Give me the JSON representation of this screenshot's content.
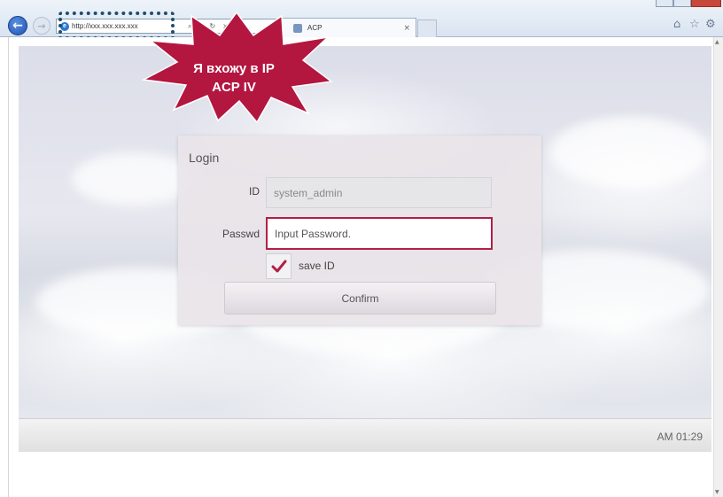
{
  "browser": {
    "address_url": "http://xxx.xxx.xxx.xxx",
    "search_icon": "search-icon",
    "address_separator": "▾",
    "refresh_icon": "↻",
    "stop_icon": "×",
    "tab_title": "ACP",
    "tab_close": "×",
    "toolbar_icons": [
      "home-icon",
      "star-icon",
      "gear-icon"
    ]
  },
  "callout": {
    "text_line1": "Я вхожу в IP",
    "text_line2": "ACP IV",
    "color": "#b3163f"
  },
  "login": {
    "title": "Login",
    "id_label": "ID",
    "id_value": "system_admin",
    "password_label": "Passwd",
    "password_placeholder": "Input Password.",
    "save_id_checked": true,
    "save_id_label": "save ID",
    "confirm_label": "Confirm",
    "accent_color": "#b22045"
  },
  "status": {
    "time": "AM 01:29"
  }
}
